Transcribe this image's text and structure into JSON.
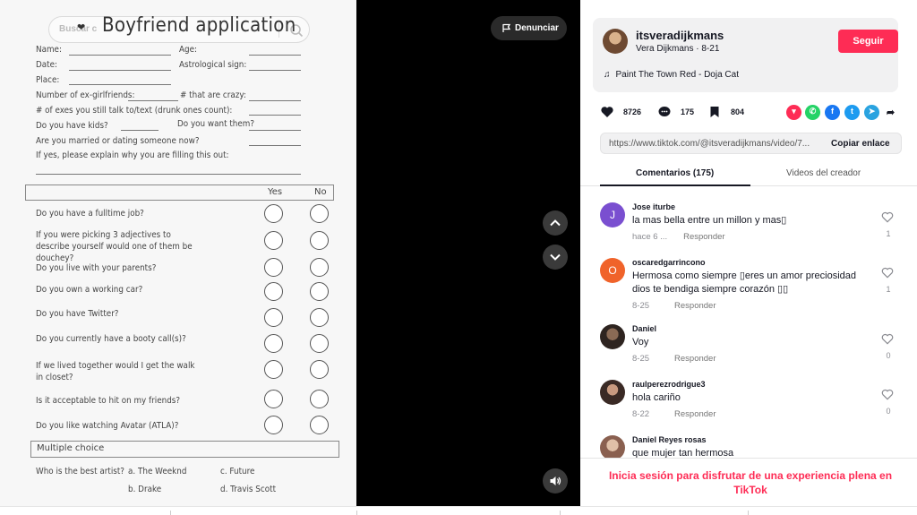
{
  "video": {
    "search_placeholder": "Buscar c",
    "doc_title": "Boyfriend application",
    "fields": {
      "name": "Name:",
      "age": "Age:",
      "date": "Date:",
      "astro": "Astrological sign:",
      "place": "Place:",
      "ex": "Number of ex-girlfriends:",
      "crazy": "# that are crazy:",
      "exes_talk": "# of exes you still talk to/text (drunk ones count):",
      "kids": "Do you have kids?",
      "want": "Do you want them?",
      "married": "Are you married or dating someone now?",
      "explain": "If yes, please explain why you are filling this out:"
    },
    "yes_label": "Yes",
    "no_label": "No",
    "questions": [
      "Do you have a fulltime job?",
      "If you were picking 3 adjectives to describe yourself would one of them be douchey?",
      "Do you live with your parents?",
      "Do you own a working car?",
      "Do you have Twitter?",
      "Do you currently have a booty call(s)?",
      "If we lived together would I get the walk in closet?",
      "Is it acceptable to hit on my friends?",
      "Do you like watching Avatar (ATLA)?"
    ],
    "multiple_choice_label": "Multiple choice",
    "artist_question": "Who is the best artist?",
    "options": [
      "a. The Weeknd",
      "c. Future",
      "b. Drake",
      "d. Travis Scott"
    ],
    "report_label": "Denunciar"
  },
  "creator": {
    "username": "itsveradijkmans",
    "display_name": "Vera Dijkmans",
    "date": "8-21",
    "follow_label": "Seguir",
    "music": "Paint The Town Red - Doja Cat"
  },
  "stats": {
    "likes": "8726",
    "comments": "175",
    "saves": "804"
  },
  "link": {
    "url": "https://www.tiktok.com/@itsveradijkmans/video/7...",
    "copy_label": "Copiar enlace"
  },
  "tabs": {
    "comments": "Comentarios (175)",
    "videos": "Videos del creador"
  },
  "comments": [
    {
      "name": "Jose iturbe",
      "text": "la mas bella entre un millon y mas▯",
      "time": "hace 6 ...",
      "reply": "Responder",
      "likes": "1",
      "avatar_letter": "J",
      "avatar_color": "#7a4fd0"
    },
    {
      "name": "oscaredgarrincono",
      "text": "Hermosa como siempre ▯eres un amor preciosidad dios te bendiga siempre corazón ▯▯",
      "time": "8-25",
      "reply": "Responder",
      "likes": "1",
      "avatar_letter": "O",
      "avatar_color": "#f0632a"
    },
    {
      "name": "Daniel",
      "text": "Voy",
      "time": "8-25",
      "reply": "Responder",
      "likes": "0",
      "avatar_letter": "",
      "avatar_color": "#4a3a30"
    },
    {
      "name": "raulperezrodrigue3",
      "text": "hola cariño",
      "time": "8-22",
      "reply": "Responder",
      "likes": "0",
      "avatar_letter": "",
      "avatar_color": "#5a4035"
    },
    {
      "name": "Daniel Reyes rosas",
      "text": "que mujer tan hermosa",
      "time": "",
      "reply": "",
      "likes": "",
      "avatar_letter": "",
      "avatar_color": "#b08a70"
    }
  ],
  "login_banner": "Inicia sesión para disfrutar de una experiencia plena en TikTok",
  "colors": {
    "accent": "#fe2c55",
    "panel": "#f1f1f2",
    "video_bg": "#000000"
  }
}
